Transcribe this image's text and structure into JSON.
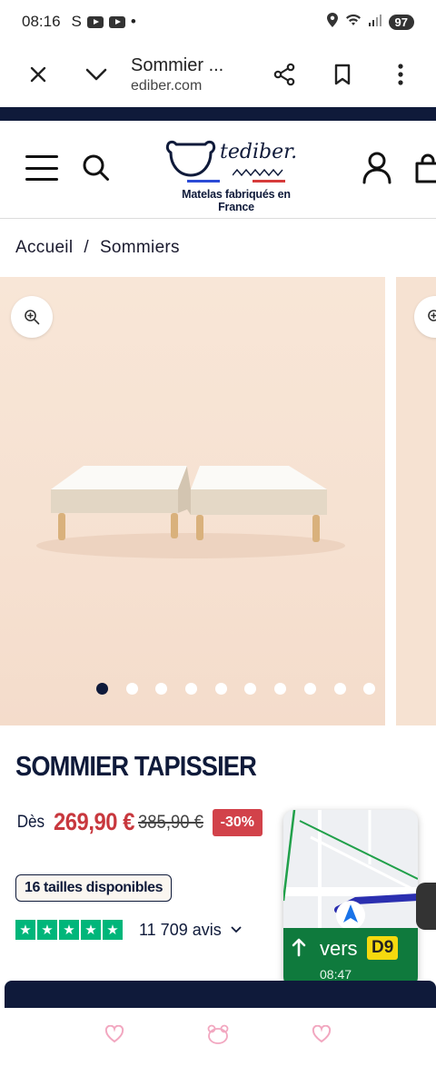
{
  "status_bar": {
    "time": "08:16",
    "s_glyph": "S",
    "dot": "•",
    "battery": "97"
  },
  "browser": {
    "title": "Sommier ...",
    "url": "ediber.com"
  },
  "site": {
    "logo_text": "tediber.",
    "tagline": "Matelas fabriqués en France"
  },
  "breadcrumb": {
    "home": "Accueil",
    "separator": "/",
    "current": "Sommiers"
  },
  "gallery": {
    "dots_count": 10,
    "active_dot": 0,
    "slide_bg": "#f7e3d3"
  },
  "product": {
    "title": "SOMMIER TAPISSIER",
    "price_prefix": "Dès",
    "price": "269,90 €",
    "old_price": "385,90 €",
    "discount": "-30%",
    "sizes": "16 tailles disponibles",
    "reviews_count": "11 709 avis",
    "rating_stars": 5
  },
  "map_overlay": {
    "direction": "vers",
    "road": "D9",
    "eta": "08:47"
  },
  "colors": {
    "navy": "#0f1a3a",
    "price_red": "#c8383e",
    "trustpilot_green": "#00b67a",
    "maps_green": "#0f7a3d"
  }
}
